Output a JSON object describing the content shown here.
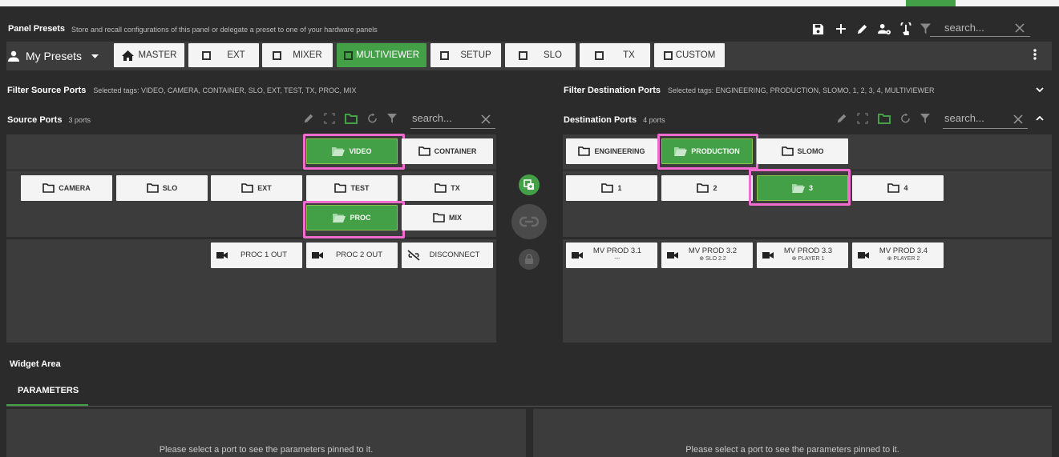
{
  "panel_presets": {
    "title": "Panel Presets",
    "description": "Store and recall configurations of this panel or delegate a preset to one of your hardware panels",
    "search_placeholder": "search...",
    "my_presets_label": "My Presets",
    "presets": [
      {
        "label": "MASTER",
        "icon": "home-icon",
        "active": false
      },
      {
        "label": "EXT",
        "icon": "box-icon",
        "active": false
      },
      {
        "label": "MIXER",
        "icon": "box-icon",
        "active": false
      },
      {
        "label": "MULTIVIEWER",
        "icon": "box-icon",
        "active": true
      },
      {
        "label": "SETUP",
        "icon": "box-icon",
        "active": false
      },
      {
        "label": "SLO",
        "icon": "box-icon",
        "active": false
      },
      {
        "label": "TX",
        "icon": "box-icon",
        "active": false
      },
      {
        "label": "CUSTOM",
        "icon": "box-icon",
        "active": false
      }
    ]
  },
  "filter_source": {
    "title": "Filter Source Ports",
    "tags": "Selected tags: VIDEO, CAMERA, CONTAINER, SLO, EXT, TEST, TX, PROC, MIX"
  },
  "filter_destination": {
    "title": "Filter Destination Ports",
    "tags": "Selected tags: ENGINEERING, PRODUCTION, SLOMO, 1, 2, 3, 4, MULTIVIEWER"
  },
  "source_ports": {
    "title": "Source Ports",
    "count": "3 ports",
    "search_placeholder": "search...",
    "row1": [
      {
        "label": "VIDEO",
        "selected": true
      },
      {
        "label": "CONTAINER",
        "selected": false
      }
    ],
    "row2": [
      {
        "label": "CAMERA"
      },
      {
        "label": "SLO"
      },
      {
        "label": "EXT"
      },
      {
        "label": "TEST"
      },
      {
        "label": "TX"
      }
    ],
    "row3": [
      {
        "label": "PROC",
        "selected": true
      },
      {
        "label": "MIX",
        "selected": false
      }
    ],
    "ports": [
      {
        "label": "PROC 1 OUT",
        "icon": "camera-icon"
      },
      {
        "label": "PROC 2 OUT",
        "icon": "camera-icon"
      },
      {
        "label": "DISCONNECT",
        "icon": "unlink-icon"
      }
    ]
  },
  "destination_ports": {
    "title": "Destination Ports",
    "count": "4 ports",
    "search_placeholder": "search...",
    "row1": [
      {
        "label": "ENGINEERING",
        "selected": false
      },
      {
        "label": "PRODUCTION",
        "selected": true
      },
      {
        "label": "SLOMO",
        "selected": false
      }
    ],
    "row2": [
      {
        "label": "1",
        "selected": false
      },
      {
        "label": "2",
        "selected": false
      },
      {
        "label": "3",
        "selected": true
      },
      {
        "label": "4",
        "selected": false
      }
    ],
    "ports": [
      {
        "label": "MV PROD 3.1",
        "sub": "---"
      },
      {
        "label": "MV PROD 3.2",
        "sub": "⊕ SLO 2.2"
      },
      {
        "label": "MV PROD 3.3",
        "sub": "⊕ PLAYER 1"
      },
      {
        "label": "MV PROD 3.4",
        "sub": "⊕ PLAYER 2"
      }
    ]
  },
  "widget_area": {
    "title": "Widget Area",
    "tab": "PARAMETERS",
    "message_left": "Please select a port to see the parameters pinned to it.",
    "message_right": "Please select a port to see the parameters pinned to it."
  },
  "colors": {
    "accent_green": "#43a047",
    "highlight_pink": "#f06ccf",
    "panel_bg": "#3c3c3c",
    "page_bg": "#2b2b2b"
  }
}
